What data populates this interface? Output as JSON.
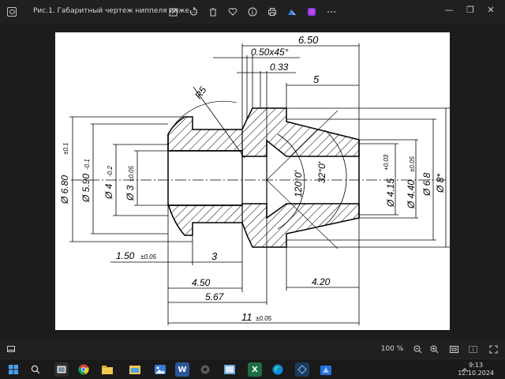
{
  "titlebar": {
    "title": "Рис.1. Габаритный чертеж ниппеля инже...",
    "icons": [
      "image-icon",
      "edit-icon",
      "rotate-icon",
      "delete-icon",
      "favorite-icon",
      "info-icon",
      "print-icon",
      "cloud-icon",
      "copilot-icon",
      "more-icon"
    ],
    "min_label": "—",
    "max_label": "❐",
    "close_label": "✕"
  },
  "drawing": {
    "labels": {
      "len_total_top": "6.50",
      "chamfer": "0.50x45°",
      "step": "0.33",
      "len_5": "5",
      "radius": "R5",
      "d680_main": "Ø 6.80",
      "d680_tol": "±0.1",
      "d590_main": "Ø 5.90",
      "d590_tol": "-0.1",
      "d4_main": "Ø 4",
      "d4_tol": "-0.2",
      "d3_main": "Ø 3",
      "d3_tol": "±0.05",
      "angle120": "120°0'",
      "angle32": "32°0'",
      "d415_main": "Ø 4.15",
      "d415_tol": "+0.03",
      "d440_main": "Ø 4.40",
      "d440_tol": "±0.05",
      "d68": "Ø 6.8",
      "d8": "Ø 8*",
      "len_150_main": "1.50",
      "len_150_tol": "±0.05",
      "len_3": "3",
      "len_450": "4.50",
      "len_420": "4.20",
      "len_567": "5.67",
      "len_11_main": "11",
      "len_11_tol": "±0.05"
    }
  },
  "statusbar": {
    "zoom": "100 %"
  },
  "taskbar": {
    "time": "9:13",
    "date": "12.10.2024"
  },
  "colors": {
    "background": "#1f1f1f",
    "paper": "#ffffff",
    "ink": "#000000"
  }
}
